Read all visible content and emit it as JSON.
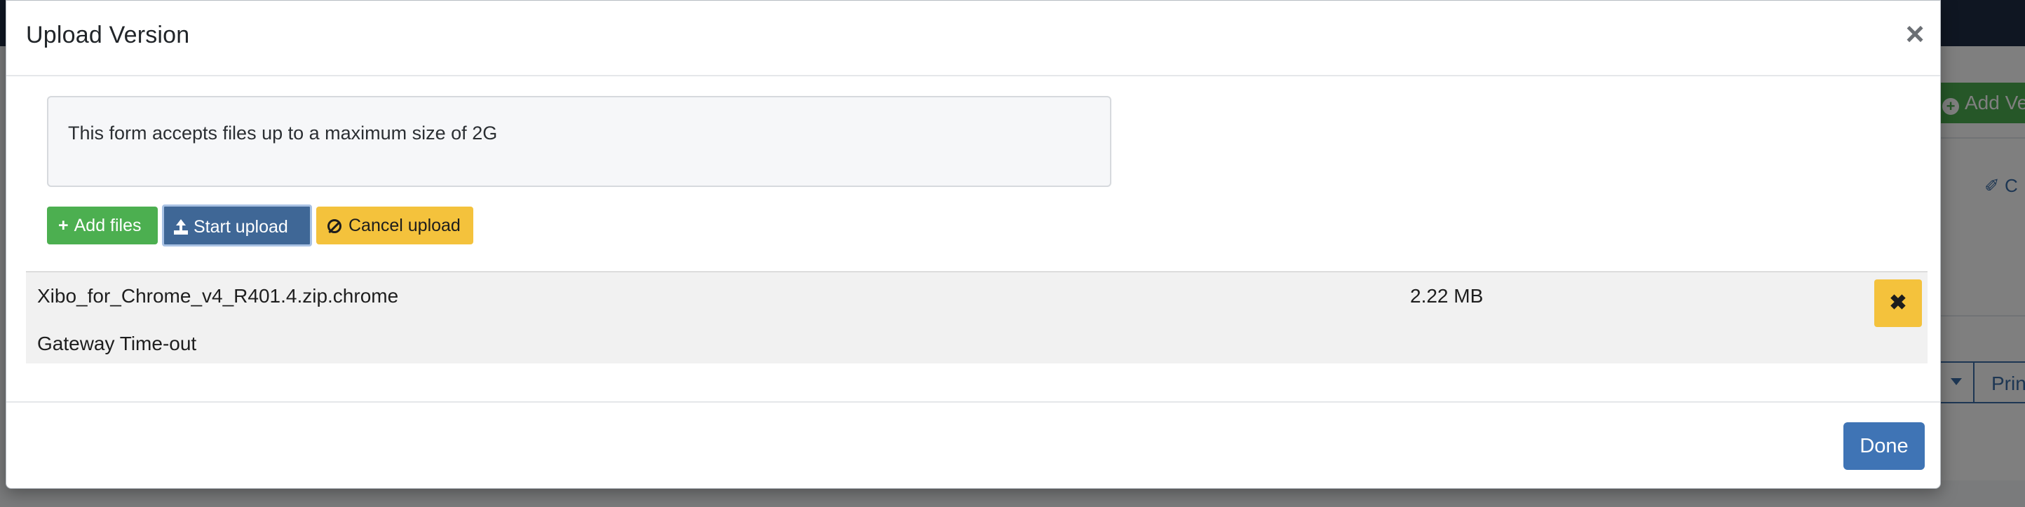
{
  "background": {
    "add_version_label": "Add Ve",
    "clear_label": "C",
    "button_group_label": "Prin"
  },
  "modal": {
    "title": "Upload Version",
    "close_glyph": "×",
    "info_text": "This form accepts files up to a maximum size of 2G"
  },
  "toolbar": {
    "add_files_label": "Add files",
    "start_upload_label": "Start upload",
    "cancel_upload_label": "Cancel upload"
  },
  "files": [
    {
      "name": "Xibo_for_Chrome_v4_R401.4.zip.chrome",
      "size": "2.22 MB",
      "error": "Gateway Time-out",
      "remove_glyph": "✖"
    }
  ],
  "footer": {
    "done_label": "Done"
  },
  "colors": {
    "success": "#4caf50",
    "primary": "#3f6796",
    "warning": "#f4c23c",
    "done": "#3f74b5"
  },
  "icons": {
    "add_files": "plus-icon",
    "start_upload": "upload-icon",
    "cancel_upload": "ban-icon",
    "remove_file": "times-icon",
    "close": "close-icon"
  }
}
